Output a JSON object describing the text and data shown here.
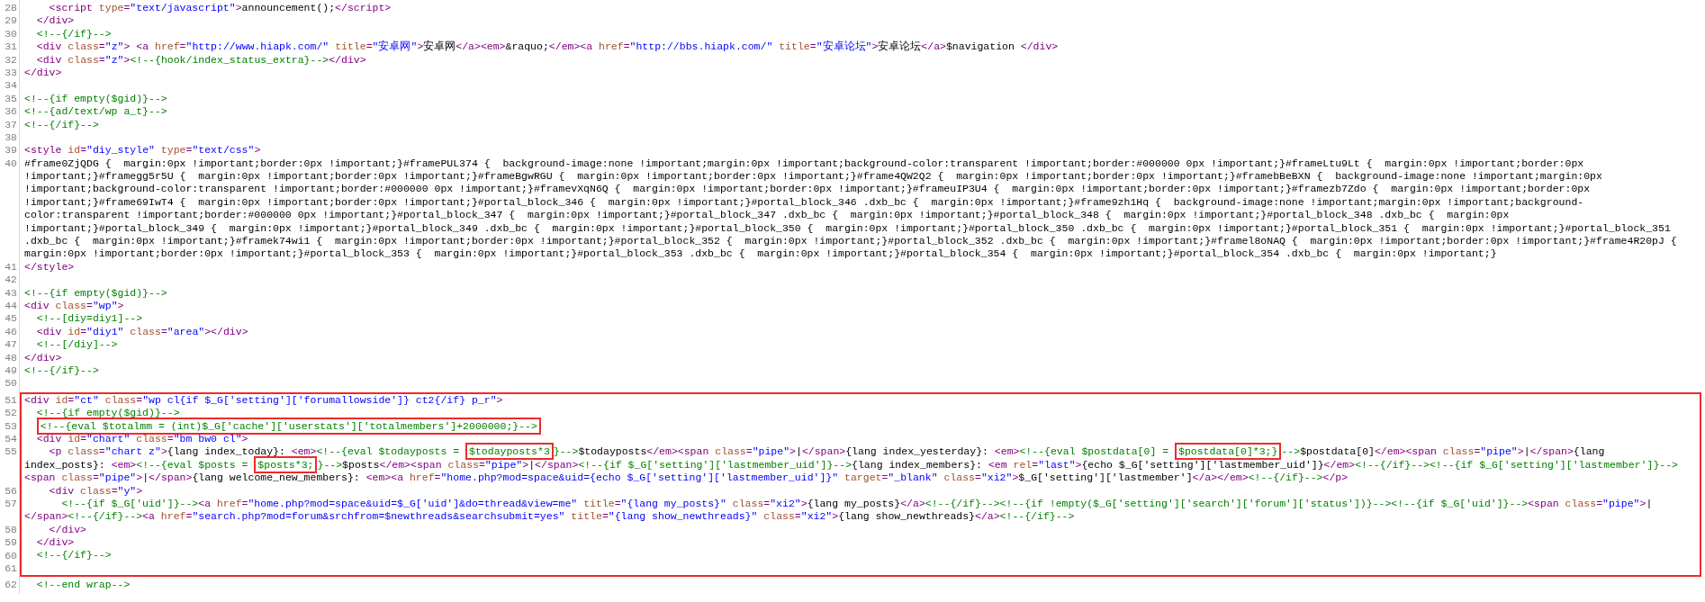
{
  "sections": [
    {
      "framed": false,
      "lines": [
        {
          "number": "28",
          "rows": [
            {
              "tokens": [
                {
                  "kind": "tag",
                  "text": "    <script"
                },
                {
                  "kind": "attr",
                  "text": " type"
                },
                {
                  "kind": "tag",
                  "text": "="
                },
                {
                  "kind": "value",
                  "text": "\"text/javascript\""
                },
                {
                  "kind": "tag",
                  "text": ">"
                },
                {
                  "kind": "text",
                  "text": "announcement();"
                },
                {
                  "kind": "tag",
                  "text": "</script>"
                }
              ]
            }
          ]
        },
        {
          "number": "29",
          "rows": [
            {
              "tokens": [
                {
                  "kind": "tag",
                  "text": "  </div>"
                }
              ]
            }
          ]
        },
        {
          "number": "30",
          "rows": [
            {
              "tokens": [
                {
                  "kind": "comment",
                  "text": "  <!--{/if}-->"
                }
              ]
            }
          ]
        },
        {
          "number": "31",
          "rows": [
            {
              "tokens": [
                {
                  "kind": "tag",
                  "text": "  <div"
                },
                {
                  "kind": "attr",
                  "text": " class"
                },
                {
                  "kind": "tag",
                  "text": "="
                },
                {
                  "kind": "value",
                  "text": "\"z\""
                },
                {
                  "kind": "tag",
                  "text": ">"
                },
                {
                  "kind": "tag",
                  "text": " <a"
                },
                {
                  "kind": "attr",
                  "text": " href"
                },
                {
                  "kind": "tag",
                  "text": "="
                },
                {
                  "kind": "value",
                  "text": "\"http://www.hiapk.com/\""
                },
                {
                  "kind": "attr",
                  "text": " title"
                },
                {
                  "kind": "tag",
                  "text": "="
                },
                {
                  "kind": "value",
                  "text": "\"安卓网\""
                },
                {
                  "kind": "tag",
                  "text": ">"
                },
                {
                  "kind": "text",
                  "text": "安卓网"
                },
                {
                  "kind": "tag",
                  "text": "</a><em>"
                },
                {
                  "kind": "text",
                  "text": "&raquo;"
                },
                {
                  "kind": "tag",
                  "text": "</em><a"
                },
                {
                  "kind": "attr",
                  "text": " href"
                },
                {
                  "kind": "tag",
                  "text": "="
                },
                {
                  "kind": "value",
                  "text": "\"http://bbs.hiapk.com/\""
                },
                {
                  "kind": "attr",
                  "text": " title"
                },
                {
                  "kind": "tag",
                  "text": "="
                },
                {
                  "kind": "value",
                  "text": "\"安卓论坛\""
                },
                {
                  "kind": "tag",
                  "text": ">"
                },
                {
                  "kind": "text",
                  "text": "安卓论坛"
                },
                {
                  "kind": "tag",
                  "text": "</a>"
                },
                {
                  "kind": "text",
                  "text": "$navigation "
                },
                {
                  "kind": "tag",
                  "text": "</div>"
                }
              ]
            }
          ]
        },
        {
          "number": "32",
          "rows": [
            {
              "tokens": [
                {
                  "kind": "tag",
                  "text": "  <div"
                },
                {
                  "kind": "attr",
                  "text": " class"
                },
                {
                  "kind": "tag",
                  "text": "="
                },
                {
                  "kind": "value",
                  "text": "\"z\""
                },
                {
                  "kind": "tag",
                  "text": ">"
                },
                {
                  "kind": "comment",
                  "text": "<!--{hook/index_status_extra}-->"
                },
                {
                  "kind": "tag",
                  "text": "</div>"
                }
              ]
            }
          ]
        },
        {
          "number": "33",
          "rows": [
            {
              "tokens": [
                {
                  "kind": "tag",
                  "text": "</div>"
                }
              ]
            }
          ]
        },
        {
          "number": "34"
        },
        {
          "number": "35",
          "rows": [
            {
              "tokens": [
                {
                  "kind": "comment",
                  "text": "<!--{if empty($gid)}-->"
                }
              ]
            }
          ]
        },
        {
          "number": "36",
          "rows": [
            {
              "tokens": [
                {
                  "kind": "comment",
                  "text": "<!--{ad/text/wp a_t}-->"
                }
              ]
            }
          ]
        },
        {
          "number": "37",
          "rows": [
            {
              "tokens": [
                {
                  "kind": "comment",
                  "text": "<!--{/if}-->"
                }
              ]
            }
          ]
        },
        {
          "number": "38"
        },
        {
          "number": "39",
          "rows": [
            {
              "tokens": [
                {
                  "kind": "tag",
                  "text": "<style"
                },
                {
                  "kind": "attr",
                  "text": " id"
                },
                {
                  "kind": "tag",
                  "text": "="
                },
                {
                  "kind": "value",
                  "text": "\"diy_style\""
                },
                {
                  "kind": "attr",
                  "text": " type"
                },
                {
                  "kind": "tag",
                  "text": "="
                },
                {
                  "kind": "value",
                  "text": "\"text/css\""
                },
                {
                  "kind": "tag",
                  "text": ">"
                }
              ]
            }
          ]
        },
        {
          "number": "40",
          "rows": [
            {
              "tokens": [
                {
                  "kind": "text",
                  "text": "#frame0ZjQDG {  margin:0px !important;border:0px !important;}#framePUL374 {  background-image:none !important;margin:0px !important;background-color:transparent !important;border:#000000 0px !important;}#frameLtu9Lt {  margin:0px !important;border:0px"
                }
              ]
            },
            {
              "tokens": [
                {
                  "kind": "text",
                  "text": "!important;}#framegg5r5U {  margin:0px !important;border:0px !important;}#frameBgwRGU {  margin:0px !important;border:0px !important;}#frame4QW2Q2 {  margin:0px !important;border:0px !important;}#framebBeBXN {  background-image:none !important;margin:0px"
                }
              ]
            },
            {
              "tokens": [
                {
                  "kind": "text",
                  "text": "!important;background-color:transparent !important;border:#000000 0px !important;}#framevXqN6Q {  margin:0px !important;border:0px !important;}#frameuIP3U4 {  margin:0px !important;border:0px !important;}#framezb7Zdo {  margin:0px !important;border:0px"
                }
              ]
            },
            {
              "tokens": [
                {
                  "kind": "text",
                  "text": "!important;}#frame69IwT4 {  margin:0px !important;border:0px !important;}#portal_block_346 {  margin:0px !important;}#portal_block_346 .dxb_bc {  margin:0px !important;}#frame9zh1Hq {  background-image:none !important;margin:0px !important;background-"
                }
              ]
            },
            {
              "tokens": [
                {
                  "kind": "text",
                  "text": "color:transparent !important;border:#000000 0px !important;}#portal_block_347 {  margin:0px !important;}#portal_block_347 .dxb_bc {  margin:0px !important;}#portal_block_348 {  margin:0px !important;}#portal_block_348 .dxb_bc {  margin:0px"
                }
              ]
            },
            {
              "tokens": [
                {
                  "kind": "text",
                  "text": "!important;}#portal_block_349 {  margin:0px !important;}#portal_block_349 .dxb_bc {  margin:0px !important;}#portal_block_350 {  margin:0px !important;}#portal_block_350 .dxb_bc {  margin:0px !important;}#portal_block_351 {  margin:0px !important;}#portal_block_351"
                }
              ]
            },
            {
              "tokens": [
                {
                  "kind": "text",
                  "text": ".dxb_bc {  margin:0px !important;}#framek74wi1 {  margin:0px !important;border:0px !important;}#portal_block_352 {  margin:0px !important;}#portal_block_352 .dxb_bc {  margin:0px !important;}#framel8oNAQ {  margin:0px !important;border:0px !important;}#frame4R20pJ {"
                }
              ]
            },
            {
              "tokens": [
                {
                  "kind": "text",
                  "text": "margin:0px !important;border:0px !important;}#portal_block_353 {  margin:0px !important;}#portal_block_353 .dxb_bc {  margin:0px !important;}#portal_block_354 {  margin:0px !important;}#portal_block_354 .dxb_bc {  margin:0px !important;}"
                }
              ]
            }
          ]
        },
        {
          "number": "41",
          "rows": [
            {
              "tokens": [
                {
                  "kind": "tag",
                  "text": "</style>"
                }
              ]
            }
          ]
        },
        {
          "number": "42"
        },
        {
          "number": "43",
          "rows": [
            {
              "tokens": [
                {
                  "kind": "comment",
                  "text": "<!--{if empty($gid)}-->"
                }
              ]
            }
          ]
        },
        {
          "number": "44",
          "rows": [
            {
              "tokens": [
                {
                  "kind": "tag",
                  "text": "<div"
                },
                {
                  "kind": "attr",
                  "text": " class"
                },
                {
                  "kind": "tag",
                  "text": "="
                },
                {
                  "kind": "value",
                  "text": "\"wp\""
                },
                {
                  "kind": "tag",
                  "text": ">"
                }
              ]
            }
          ]
        },
        {
          "number": "45",
          "rows": [
            {
              "tokens": [
                {
                  "kind": "comment",
                  "text": "  <!--[diy=diy1]-->"
                }
              ]
            }
          ]
        },
        {
          "number": "46",
          "rows": [
            {
              "tokens": [
                {
                  "kind": "tag",
                  "text": "  <div"
                },
                {
                  "kind": "attr",
                  "text": " id"
                },
                {
                  "kind": "tag",
                  "text": "="
                },
                {
                  "kind": "value",
                  "text": "\"diy1\""
                },
                {
                  "kind": "attr",
                  "text": " class"
                },
                {
                  "kind": "tag",
                  "text": "="
                },
                {
                  "kind": "value",
                  "text": "\"area\""
                },
                {
                  "kind": "tag",
                  "text": "></div>"
                }
              ]
            }
          ]
        },
        {
          "number": "47",
          "rows": [
            {
              "tokens": [
                {
                  "kind": "comment",
                  "text": "  <!--[/diy]-->"
                }
              ]
            }
          ]
        },
        {
          "number": "48",
          "rows": [
            {
              "tokens": [
                {
                  "kind": "tag",
                  "text": "</div>"
                }
              ]
            }
          ]
        },
        {
          "number": "49",
          "rows": [
            {
              "tokens": [
                {
                  "kind": "comment",
                  "text": "<!--{/if}-->"
                }
              ]
            }
          ]
        },
        {
          "number": "50"
        }
      ]
    },
    {
      "framed": true,
      "lines": [
        {
          "number": "51",
          "rows": [
            {
              "tokens": [
                {
                  "kind": "tag",
                  "text": "<div"
                },
                {
                  "kind": "attr",
                  "text": " id"
                },
                {
                  "kind": "tag",
                  "text": "="
                },
                {
                  "kind": "value",
                  "text": "\"ct\""
                },
                {
                  "kind": "attr",
                  "text": " class"
                },
                {
                  "kind": "tag",
                  "text": "="
                },
                {
                  "kind": "value",
                  "text": "\"wp cl{if $_G['setting']['forumallowside']} ct2{/if} p_r\""
                },
                {
                  "kind": "tag",
                  "text": ">"
                }
              ]
            }
          ]
        },
        {
          "number": "52",
          "rows": [
            {
              "tokens": [
                {
                  "kind": "comment",
                  "text": "  <!--{if empty($gid)}-->"
                }
              ]
            }
          ]
        },
        {
          "number": "53",
          "rows": [
            {
              "tokens": [
                {
                  "kind": "boxed",
                  "text": "  <!--{eval $totalmm = (int)$_G['cache']['userstats']['totalmembers']+2000000;}-->"
                }
              ]
            }
          ]
        },
        {
          "number": "54",
          "rows": [
            {
              "tokens": [
                {
                  "kind": "tag",
                  "text": "  <div"
                },
                {
                  "kind": "attr",
                  "text": " id"
                },
                {
                  "kind": "tag",
                  "text": "="
                },
                {
                  "kind": "value",
                  "text": "\"chart\""
                },
                {
                  "kind": "attr",
                  "text": " class"
                },
                {
                  "kind": "tag",
                  "text": "="
                },
                {
                  "kind": "value",
                  "text": "\"bm bw0 cl\""
                },
                {
                  "kind": "tag",
                  "text": ">"
                }
              ]
            }
          ]
        },
        {
          "number": "55",
          "rows": [
            {
              "tokens": [
                {
                  "kind": "tag",
                  "text": "    <p"
                },
                {
                  "kind": "attr",
                  "text": " class"
                },
                {
                  "kind": "tag",
                  "text": "="
                },
                {
                  "kind": "value",
                  "text": "\"chart z\""
                },
                {
                  "kind": "tag",
                  "text": ">"
                },
                {
                  "kind": "text",
                  "text": "{lang index_today}: "
                },
                {
                  "kind": "tag",
                  "text": "<em>"
                },
                {
                  "kind": "comment",
                  "text": "<!--{eval $todayposts = "
                },
                {
                  "kind": "boxed",
                  "text": "$todayposts*3"
                },
                {
                  "kind": "comment",
                  "text": "}-->"
                },
                {
                  "kind": "text",
                  "text": "$todayposts"
                },
                {
                  "kind": "tag",
                  "text": "</em><span"
                },
                {
                  "kind": "attr",
                  "text": " class"
                },
                {
                  "kind": "tag",
                  "text": "="
                },
                {
                  "kind": "value",
                  "text": "\"pipe\""
                },
                {
                  "kind": "tag",
                  "text": ">"
                },
                {
                  "kind": "text",
                  "text": "|"
                },
                {
                  "kind": "tag",
                  "text": "</span>"
                },
                {
                  "kind": "text",
                  "text": "{lang index_yesterday}: "
                },
                {
                  "kind": "tag",
                  "text": "<em>"
                },
                {
                  "kind": "comment",
                  "text": "<!--{eval $postdata[0] = "
                },
                {
                  "kind": "boxed",
                  "text": "$postdata[0]*3;}"
                },
                {
                  "kind": "comment",
                  "text": "-->"
                },
                {
                  "kind": "text",
                  "text": "$postdata[0]"
                },
                {
                  "kind": "tag",
                  "text": "</em><span"
                },
                {
                  "kind": "attr",
                  "text": " class"
                },
                {
                  "kind": "tag",
                  "text": "="
                },
                {
                  "kind": "value",
                  "text": "\"pipe\""
                },
                {
                  "kind": "tag",
                  "text": ">"
                },
                {
                  "kind": "text",
                  "text": "|"
                },
                {
                  "kind": "tag",
                  "text": "</span>"
                },
                {
                  "kind": "text",
                  "text": "{lang"
                }
              ]
            },
            {
              "tokens": [
                {
                  "kind": "text",
                  "text": "index_posts}: "
                },
                {
                  "kind": "tag",
                  "text": "<em>"
                },
                {
                  "kind": "comment",
                  "text": "<!--{eval $posts = "
                },
                {
                  "kind": "boxed",
                  "text": "$posts*3;"
                },
                {
                  "kind": "comment",
                  "text": "}-->"
                },
                {
                  "kind": "text",
                  "text": "$posts"
                },
                {
                  "kind": "tag",
                  "text": "</em><span"
                },
                {
                  "kind": "attr",
                  "text": " class"
                },
                {
                  "kind": "tag",
                  "text": "="
                },
                {
                  "kind": "value",
                  "text": "\"pipe\""
                },
                {
                  "kind": "tag",
                  "text": ">"
                },
                {
                  "kind": "text",
                  "text": "|"
                },
                {
                  "kind": "tag",
                  "text": "</span>"
                },
                {
                  "kind": "comment",
                  "text": "<!--{if $_G['setting']['lastmember_uid']}-->"
                },
                {
                  "kind": "text",
                  "text": "{lang index_members}: "
                },
                {
                  "kind": "tag",
                  "text": "<em"
                },
                {
                  "kind": "attr",
                  "text": " rel"
                },
                {
                  "kind": "tag",
                  "text": "="
                },
                {
                  "kind": "value",
                  "text": "\"last\""
                },
                {
                  "kind": "tag",
                  "text": ">"
                },
                {
                  "kind": "text",
                  "text": "{echo $_G['setting']['lastmember_uid']}"
                },
                {
                  "kind": "tag",
                  "text": "</em>"
                },
                {
                  "kind": "comment",
                  "text": "<!--{/if}--><!--{if $_G['setting']['lastmember']}-->"
                }
              ]
            },
            {
              "tokens": [
                {
                  "kind": "tag",
                  "text": "<span"
                },
                {
                  "kind": "attr",
                  "text": " class"
                },
                {
                  "kind": "tag",
                  "text": "="
                },
                {
                  "kind": "value",
                  "text": "\"pipe\""
                },
                {
                  "kind": "tag",
                  "text": ">"
                },
                {
                  "kind": "text",
                  "text": "|"
                },
                {
                  "kind": "tag",
                  "text": "</span>"
                },
                {
                  "kind": "text",
                  "text": "{lang welcome_new_members}: "
                },
                {
                  "kind": "tag",
                  "text": "<em><a"
                },
                {
                  "kind": "attr",
                  "text": " href"
                },
                {
                  "kind": "tag",
                  "text": "="
                },
                {
                  "kind": "value",
                  "text": "\"home.php?mod=space&uid={echo $_G['setting']['lastmember_uid']}\""
                },
                {
                  "kind": "attr",
                  "text": " target"
                },
                {
                  "kind": "tag",
                  "text": "="
                },
                {
                  "kind": "value",
                  "text": "\"_blank\""
                },
                {
                  "kind": "attr",
                  "text": " class"
                },
                {
                  "kind": "tag",
                  "text": "="
                },
                {
                  "kind": "value",
                  "text": "\"xi2\""
                },
                {
                  "kind": "tag",
                  "text": ">"
                },
                {
                  "kind": "text",
                  "text": "$_G['setting']['lastmember']"
                },
                {
                  "kind": "tag",
                  "text": "</a></em>"
                },
                {
                  "kind": "comment",
                  "text": "<!--{/if}-->"
                },
                {
                  "kind": "tag",
                  "text": "</p>"
                }
              ]
            }
          ]
        },
        {
          "number": "56",
          "rows": [
            {
              "tokens": [
                {
                  "kind": "tag",
                  "text": "    <div"
                },
                {
                  "kind": "attr",
                  "text": " class"
                },
                {
                  "kind": "tag",
                  "text": "="
                },
                {
                  "kind": "value",
                  "text": "\"y\""
                },
                {
                  "kind": "tag",
                  "text": ">"
                }
              ]
            }
          ]
        },
        {
          "number": "57",
          "rows": [
            {
              "tokens": [
                {
                  "kind": "comment",
                  "text": "      <!--{if $_G['uid']}-->"
                },
                {
                  "kind": "tag",
                  "text": "<a"
                },
                {
                  "kind": "attr",
                  "text": " href"
                },
                {
                  "kind": "tag",
                  "text": "="
                },
                {
                  "kind": "value",
                  "text": "\"home.php?mod=space&uid=$_G['uid']&do=thread&view=me\""
                },
                {
                  "kind": "attr",
                  "text": " title"
                },
                {
                  "kind": "tag",
                  "text": "="
                },
                {
                  "kind": "value",
                  "text": "\"{lang my_posts}\""
                },
                {
                  "kind": "attr",
                  "text": " class"
                },
                {
                  "kind": "tag",
                  "text": "="
                },
                {
                  "kind": "value",
                  "text": "\"xi2\""
                },
                {
                  "kind": "tag",
                  "text": ">"
                },
                {
                  "kind": "text",
                  "text": "{lang my_posts}"
                },
                {
                  "kind": "tag",
                  "text": "</a>"
                },
                {
                  "kind": "comment",
                  "text": "<!--{/if}--><!--{if !empty($_G['setting']['search']['forum']['status'])}--><!--{if $_G['uid']}-->"
                },
                {
                  "kind": "tag",
                  "text": "<span"
                },
                {
                  "kind": "attr",
                  "text": " class"
                },
                {
                  "kind": "tag",
                  "text": "="
                },
                {
                  "kind": "value",
                  "text": "\"pipe\""
                },
                {
                  "kind": "tag",
                  "text": ">"
                },
                {
                  "kind": "text",
                  "text": "|"
                }
              ]
            },
            {
              "tokens": [
                {
                  "kind": "tag",
                  "text": "</span>"
                },
                {
                  "kind": "comment",
                  "text": "<!--{/if}-->"
                },
                {
                  "kind": "tag",
                  "text": "<a"
                },
                {
                  "kind": "attr",
                  "text": " href"
                },
                {
                  "kind": "tag",
                  "text": "="
                },
                {
                  "kind": "value",
                  "text": "\"search.php?mod=forum&srchfrom=$newthreads&searchsubmit=yes\""
                },
                {
                  "kind": "attr",
                  "text": " title"
                },
                {
                  "kind": "tag",
                  "text": "="
                },
                {
                  "kind": "value",
                  "text": "\"{lang show_newthreads}\""
                },
                {
                  "kind": "attr",
                  "text": " class"
                },
                {
                  "kind": "tag",
                  "text": "="
                },
                {
                  "kind": "value",
                  "text": "\"xi2\""
                },
                {
                  "kind": "tag",
                  "text": ">"
                },
                {
                  "kind": "text",
                  "text": "{lang show_newthreads}"
                },
                {
                  "kind": "tag",
                  "text": "</a>"
                },
                {
                  "kind": "comment",
                  "text": "<!--{/if}-->"
                }
              ]
            }
          ]
        },
        {
          "number": "58",
          "rows": [
            {
              "tokens": [
                {
                  "kind": "tag",
                  "text": "    </div>"
                }
              ]
            }
          ]
        },
        {
          "number": "59",
          "rows": [
            {
              "tokens": [
                {
                  "kind": "tag",
                  "text": "  </div>"
                }
              ]
            }
          ]
        },
        {
          "number": "60",
          "rows": [
            {
              "tokens": [
                {
                  "kind": "comment",
                  "text": "  <!--{/if}-->"
                }
              ]
            }
          ]
        },
        {
          "number": "61"
        }
      ]
    },
    {
      "framed": false,
      "lines": [
        {
          "number": "62",
          "rows": [
            {
              "tokens": [
                {
                  "kind": "comment",
                  "text": "  <!--end wrap-->"
                }
              ]
            }
          ]
        }
      ]
    }
  ]
}
